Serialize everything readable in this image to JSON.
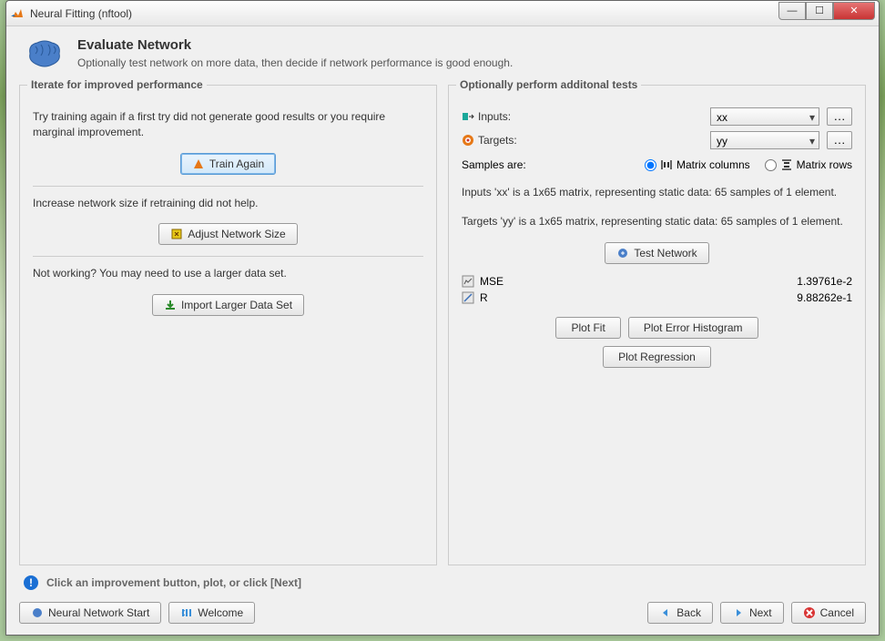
{
  "window": {
    "title": "Neural Fitting (nftool)"
  },
  "header": {
    "title": "Evaluate Network",
    "subtitle": "Optionally test network on more data, then decide if network performance is good enough."
  },
  "left": {
    "panelTitle": "Iterate for improved performance",
    "sec1Text": "Try training again if a first try did not generate good results or you require marginal improvement.",
    "trainAgain": "Train Again",
    "sec2Text": "Increase network size if retraining did not help.",
    "adjustSize": "Adjust Network Size",
    "sec3Text": "Not working? You may need to use a larger data set.",
    "importData": "Import Larger Data Set"
  },
  "right": {
    "panelTitle": "Optionally perform additonal tests",
    "inputsLabel": "Inputs:",
    "inputsValue": "xx",
    "targetsLabel": "Targets:",
    "targetsValue": "yy",
    "samplesLabel": "Samples are:",
    "matrixColumns": "Matrix columns",
    "matrixRows": "Matrix rows",
    "inputsDesc": "Inputs 'xx' is a 1x65 matrix, representing static data: 65 samples of 1 element.",
    "targetsDesc": "Targets 'yy' is a 1x65 matrix, representing static data: 65 samples of 1 element.",
    "testNetwork": "Test Network",
    "mseLabel": "MSE",
    "mseValue": "1.39761e-2",
    "rLabel": "R",
    "rValue": "9.88262e-1",
    "plotFit": "Plot Fit",
    "plotErrorHist": "Plot Error Histogram",
    "plotRegression": "Plot Regression"
  },
  "hint": "Click an improvement button, plot, or click [Next]",
  "footer": {
    "nnStart": "Neural Network Start",
    "welcome": "Welcome",
    "back": "Back",
    "next": "Next",
    "cancel": "Cancel"
  }
}
